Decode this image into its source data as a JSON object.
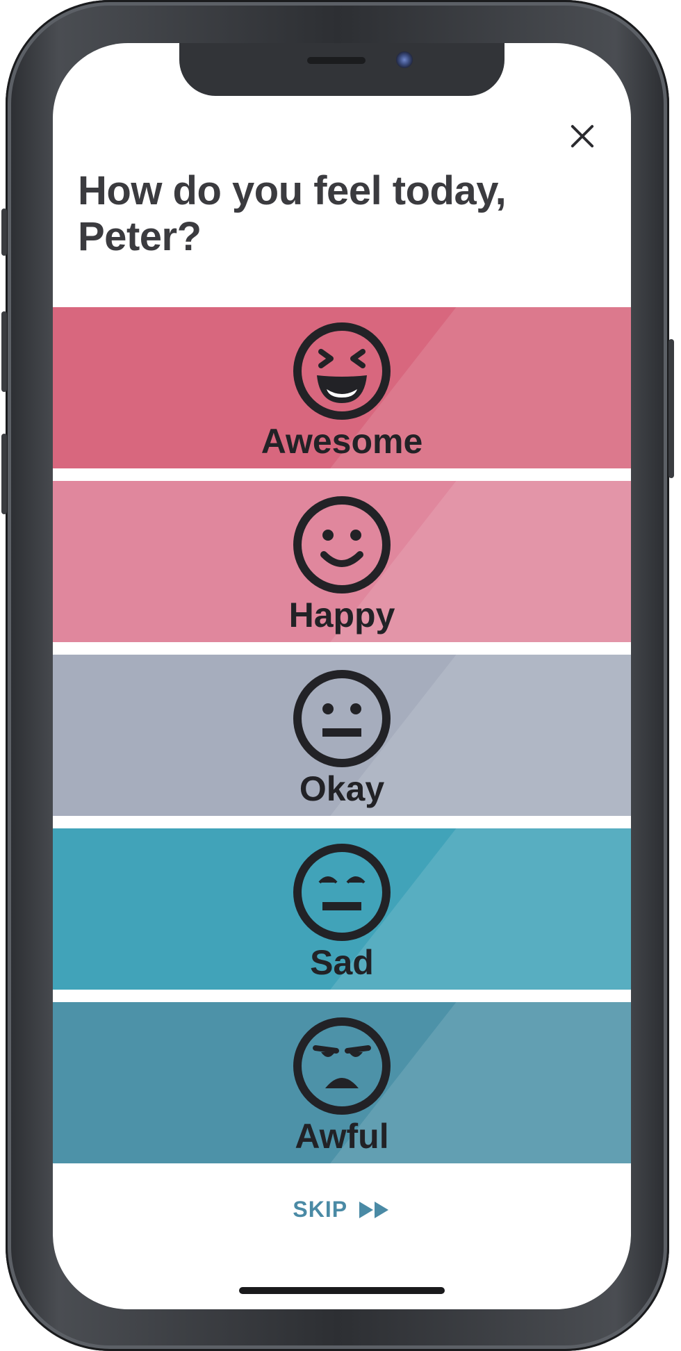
{
  "header": {
    "question": "How do you feel today, Peter?"
  },
  "moods": [
    {
      "label": "Awesome",
      "icon": "awesome-face-icon",
      "color": "#d8677e"
    },
    {
      "label": "Happy",
      "icon": "happy-face-icon",
      "color": "#e0879d"
    },
    {
      "label": "Okay",
      "icon": "neutral-face-icon",
      "color": "#a6adbd"
    },
    {
      "label": "Sad",
      "icon": "sad-face-icon",
      "color": "#41a3b9"
    },
    {
      "label": "Awful",
      "icon": "awful-face-icon",
      "color": "#4d92a8"
    }
  ],
  "footer": {
    "skip_label": "SKIP",
    "skip_color": "#4a8aa5"
  },
  "icons": {
    "close": "close-icon",
    "skip": "fast-forward-icon"
  }
}
